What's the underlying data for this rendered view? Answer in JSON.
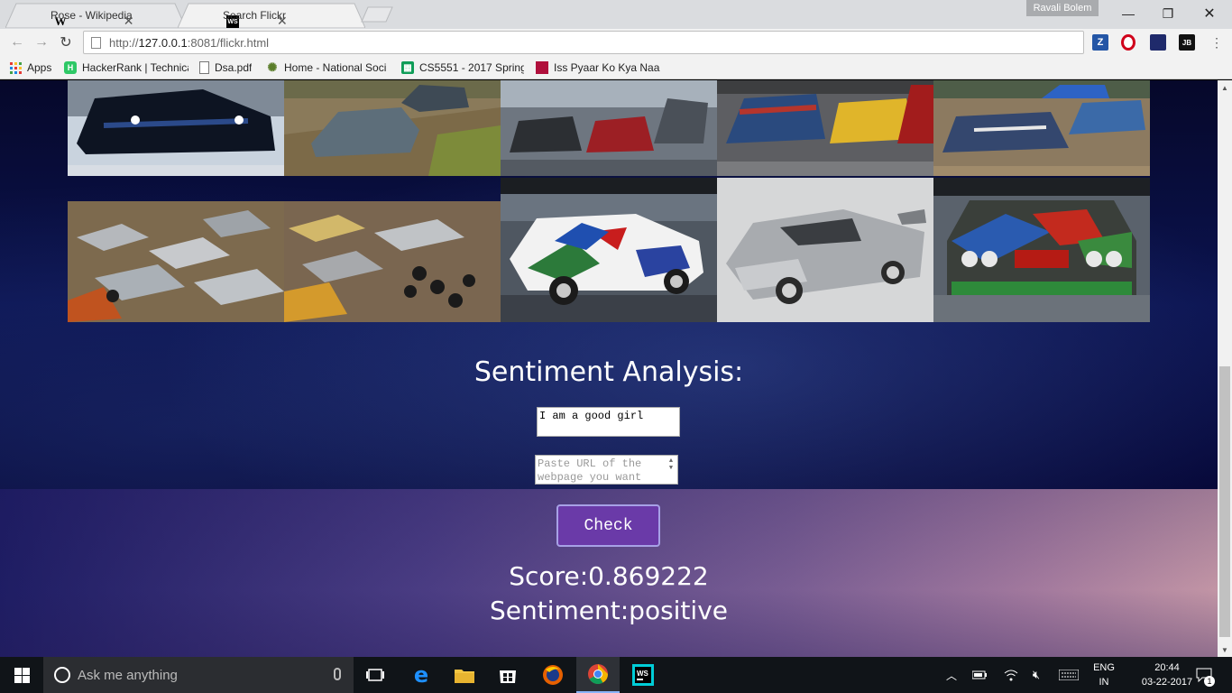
{
  "browser": {
    "tabs": [
      {
        "title": "Rose - Wikipedia",
        "favicon": "W",
        "active": false
      },
      {
        "title": "Search Flickr",
        "favicon": "WS",
        "active": true
      }
    ],
    "profile": "Ravali Bolem",
    "url_prefix": "http://",
    "url_host": "127.0.0.1",
    "url_rest": ":8081/flickr.html",
    "bookmarks": [
      {
        "label": "Apps",
        "icon": "apps-grid-icon"
      },
      {
        "label": "HackerRank | Technica",
        "icon": "hackerrank-icon"
      },
      {
        "label": "Dsa.pdf",
        "icon": "document-icon"
      },
      {
        "label": "Home - National Soci",
        "icon": "society-logo-icon"
      },
      {
        "label": "CS5551 - 2017 Spring",
        "icon": "sheets-icon"
      },
      {
        "label": "Iss Pyaar Ko Kya Naam",
        "icon": "show-icon"
      }
    ],
    "extensions": [
      "Z",
      "O",
      "B",
      "JB"
    ]
  },
  "page": {
    "gallery": {
      "row1": [
        "race-car-night",
        "rally-cars-dirt",
        "demolition-parking",
        "muscle-cars-crash",
        "derby-cars-dust"
      ],
      "row2": [
        "wrecked-cars-pile",
        "demolition-derby-tires",
        "art-car-bmw-side",
        "silver-tuner-car",
        "art-car-bmw-front"
      ]
    },
    "sentiment_title": "Sentiment Analysis:",
    "text_input_value": "I am a good girl",
    "url_input_placeholder": "Paste URL of the webpage you want",
    "check_button": "Check",
    "score_text": "Score:0.869222",
    "sentiment_text": "Sentiment:positive"
  },
  "taskbar": {
    "search_placeholder": "Ask me anything",
    "language_line1": "ENG",
    "language_line2": "IN",
    "time": "20:44",
    "date": "03-22-2017",
    "notification_count": "1"
  },
  "colors": {
    "check_button_bg": "#6a3aa8",
    "check_button_border": "#a7a1e6",
    "page_bg_top": "#0b1350",
    "footer_bg": "#7d6095"
  }
}
